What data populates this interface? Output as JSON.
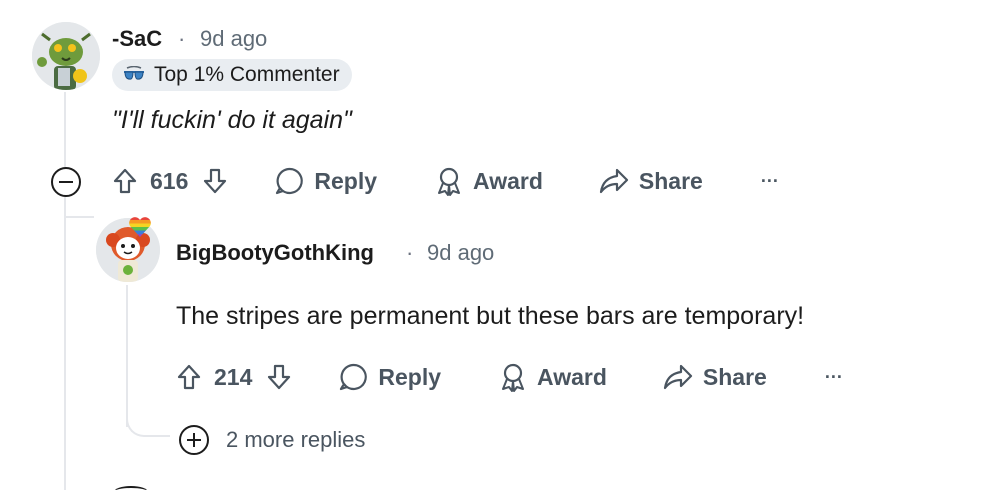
{
  "comments": [
    {
      "username": "-SaC",
      "separator": "·",
      "time": "9d ago",
      "flair": {
        "text": "Top 1% Commenter",
        "icon": "sunglasses-icon"
      },
      "body": "\"I'll fuckin' do it again\"",
      "votes": "616",
      "actions": {
        "reply": "Reply",
        "award": "Award",
        "share": "Share",
        "more": "···"
      }
    },
    {
      "username": "BigBootyGothKing",
      "separator": "·",
      "time": "9d ago",
      "badge_icon": "rainbow-heart-icon",
      "body": "The stripes are permanent but these bars are temporary!",
      "votes": "214",
      "actions": {
        "reply": "Reply",
        "award": "Award",
        "share": "Share",
        "more": "···"
      }
    }
  ],
  "more_replies": "2 more replies",
  "colors": {
    "thread_line": "#e5e7eb",
    "flair_bg": "#e9edf1",
    "muted_text": "#4a5560"
  }
}
